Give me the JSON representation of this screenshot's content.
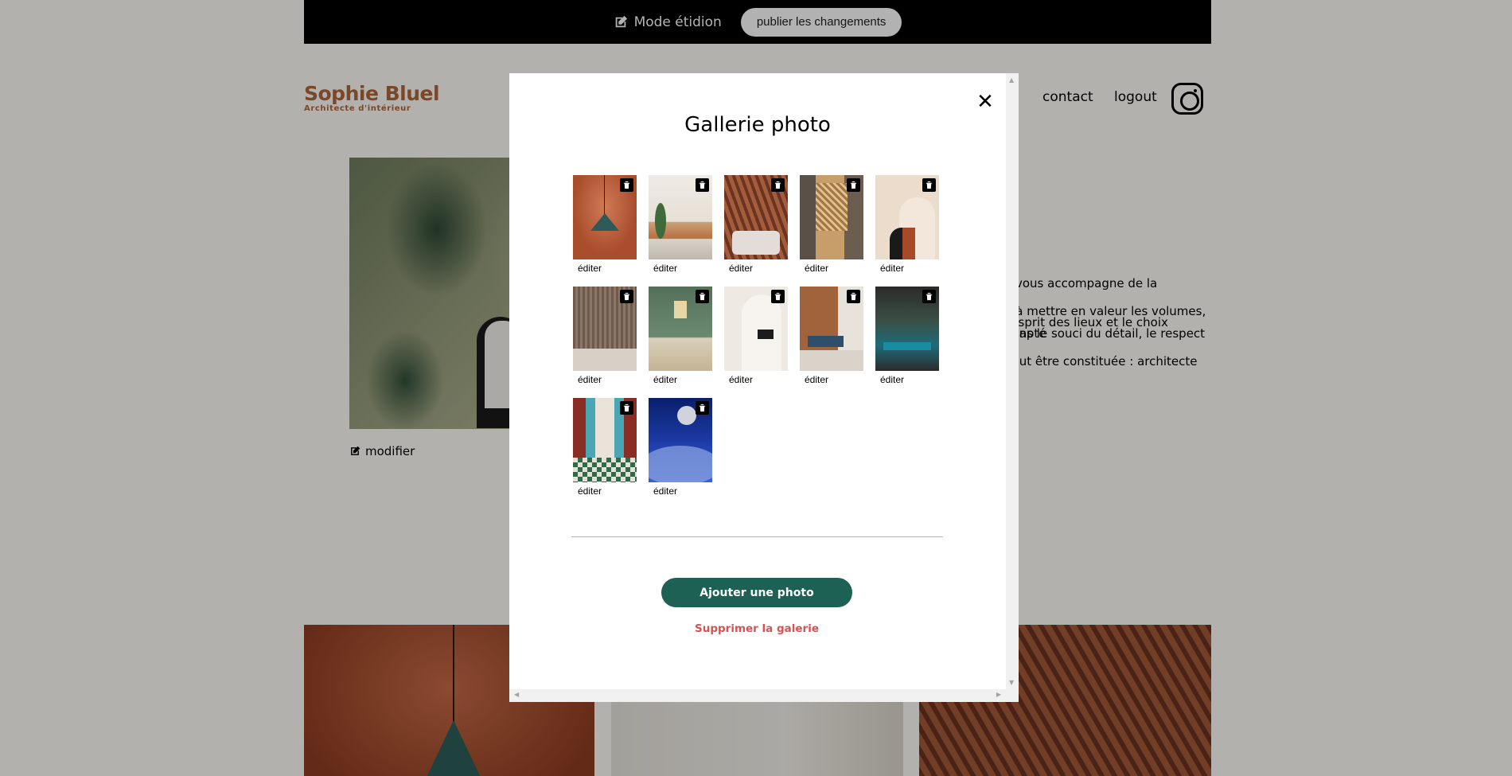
{
  "banner": {
    "edit_mode_label": "Mode étidion",
    "publish_label": "publier les changements"
  },
  "header": {
    "logo_name": "Sophie Bluel",
    "logo_subtitle": "Architecte d'intérieur",
    "nav": [
      "contact",
      "logout"
    ],
    "instagram_icon": "instagram-icon"
  },
  "intro": {
    "modify_label": "modifier",
    "text_lines": [
      "e vous accompagne de la",
      "n à mettre en valeur les volumes,",
      "l'esprit des lieux et le choix adapté",
      "dans le souci du détail, le respect",
      "peut être constituée : architecte"
    ]
  },
  "modal": {
    "title": "Gallerie photo",
    "close_label": "✕",
    "edit_label": "éditer",
    "add_photo_label": "Ajouter une photo",
    "delete_gallery_label": "Supprimer la galerie",
    "thumbnails": [
      {
        "id": "abajour-tahina",
        "edit": "éditer"
      },
      {
        "id": "appartement-paris-v",
        "edit": "éditer"
      },
      {
        "id": "restaurant-sushisen",
        "edit": "éditer"
      },
      {
        "id": "villa-la-balisiere",
        "edit": "éditer"
      },
      {
        "id": "structures-thermopolis",
        "edit": "éditer"
      },
      {
        "id": "appartement-paris-x",
        "edit": "éditer"
      },
      {
        "id": "pavillon-rue-de-paris",
        "edit": "éditer"
      },
      {
        "id": "appartement-paris-xviii",
        "edit": "éditer"
      },
      {
        "id": "bar-lullaby",
        "edit": "éditer"
      },
      {
        "id": "hotel-first-arte",
        "edit": "éditer"
      },
      {
        "id": "restaurant-le-coteaux",
        "edit": "éditer"
      },
      {
        "id": "moon-night-sky",
        "edit": "éditer"
      }
    ]
  },
  "colors": {
    "accent_green": "#1D6154",
    "danger_red": "#D65353",
    "logo_brown": "#B1663C"
  }
}
